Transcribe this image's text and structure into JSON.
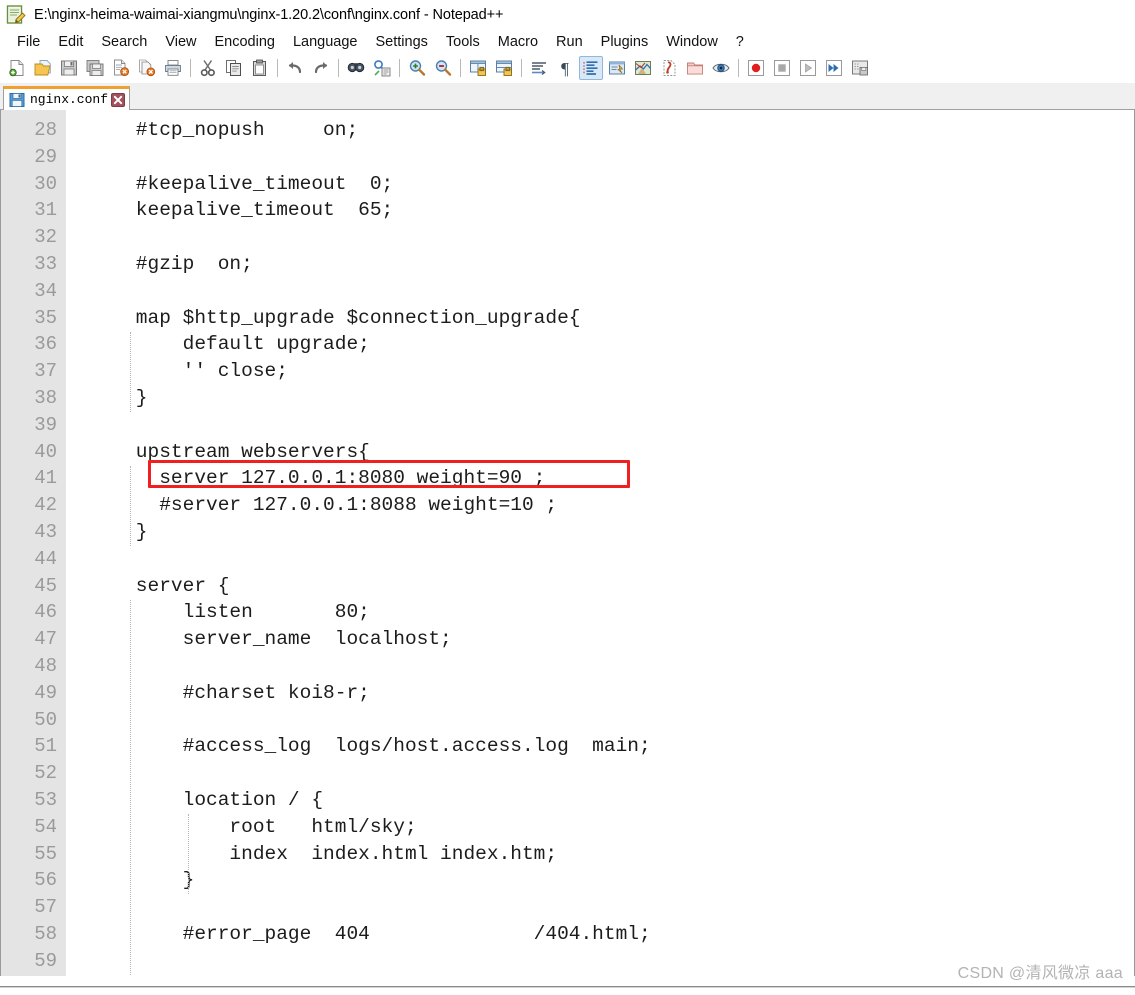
{
  "window": {
    "title": "E:\\nginx-heima-waimai-xiangmu\\nginx-1.20.2\\conf\\nginx.conf - Notepad++",
    "app_icon": "notepad-plus-plus-icon"
  },
  "menubar": {
    "items": [
      {
        "label": "File",
        "name": "menu-file"
      },
      {
        "label": "Edit",
        "name": "menu-edit"
      },
      {
        "label": "Search",
        "name": "menu-search"
      },
      {
        "label": "View",
        "name": "menu-view"
      },
      {
        "label": "Encoding",
        "name": "menu-encoding"
      },
      {
        "label": "Language",
        "name": "menu-language"
      },
      {
        "label": "Settings",
        "name": "menu-settings"
      },
      {
        "label": "Tools",
        "name": "menu-tools"
      },
      {
        "label": "Macro",
        "name": "menu-macro"
      },
      {
        "label": "Run",
        "name": "menu-run"
      },
      {
        "label": "Plugins",
        "name": "menu-plugins"
      },
      {
        "label": "Window",
        "name": "menu-window"
      },
      {
        "label": "?",
        "name": "menu-help"
      }
    ]
  },
  "toolbar": {
    "buttons": [
      {
        "icon": "new-file-icon",
        "label": "New"
      },
      {
        "icon": "open-file-icon",
        "label": "Open"
      },
      {
        "icon": "save-icon",
        "label": "Save"
      },
      {
        "icon": "save-all-icon",
        "label": "Save All"
      },
      {
        "icon": "close-file-icon",
        "label": "Close"
      },
      {
        "icon": "close-all-icon",
        "label": "Close All"
      },
      {
        "icon": "print-icon",
        "label": "Print"
      },
      {
        "sep": true
      },
      {
        "icon": "cut-icon",
        "label": "Cut"
      },
      {
        "icon": "copy-icon",
        "label": "Copy"
      },
      {
        "icon": "paste-icon",
        "label": "Paste"
      },
      {
        "sep": true
      },
      {
        "icon": "undo-icon",
        "label": "Undo"
      },
      {
        "icon": "redo-icon",
        "label": "Redo"
      },
      {
        "sep": true
      },
      {
        "icon": "find-icon",
        "label": "Find"
      },
      {
        "icon": "replace-icon",
        "label": "Replace"
      },
      {
        "sep": true
      },
      {
        "icon": "zoom-in-icon",
        "label": "Zoom In"
      },
      {
        "icon": "zoom-out-icon",
        "label": "Zoom Out"
      },
      {
        "sep": true
      },
      {
        "icon": "sync-vertical-icon",
        "label": "Synchronize Vertical Scrolling"
      },
      {
        "icon": "sync-horizontal-icon",
        "label": "Synchronize Horizontal Scrolling"
      },
      {
        "sep": true
      },
      {
        "icon": "word-wrap-icon",
        "label": "Word wrap"
      },
      {
        "icon": "show-all-chars-icon",
        "label": "Show All Characters"
      },
      {
        "icon": "indent-guide-icon",
        "label": "Show Indent Guide",
        "active": true
      },
      {
        "icon": "user-defined-dialog-icon",
        "label": "User Defined Dialogue"
      },
      {
        "icon": "document-map-icon",
        "label": "Document Map"
      },
      {
        "icon": "function-list-icon",
        "label": "Function List"
      },
      {
        "icon": "folder-workspace-icon",
        "label": "Folder as Workspace"
      },
      {
        "icon": "monitoring-icon",
        "label": "Monitoring"
      },
      {
        "sep": true
      },
      {
        "icon": "record-macro-icon",
        "label": "Start Recording"
      },
      {
        "icon": "stop-macro-icon",
        "label": "Stop Recording"
      },
      {
        "icon": "play-macro-icon",
        "label": "Playback"
      },
      {
        "icon": "run-multiple-macro-icon",
        "label": "Run a Macro Multiple Times"
      },
      {
        "icon": "save-macro-icon",
        "label": "Save Current Recorded Macro"
      }
    ]
  },
  "tabs": [
    {
      "label": "nginx.conf",
      "icon": "saved-file-icon",
      "close_icon": "close-icon",
      "active": true
    }
  ],
  "editor": {
    "first_line_number": 28,
    "lines": [
      {
        "n": 28,
        "text": "    #tcp_nopush     on;"
      },
      {
        "n": 29,
        "text": ""
      },
      {
        "n": 30,
        "text": "    #keepalive_timeout  0;"
      },
      {
        "n": 31,
        "text": "    keepalive_timeout  65;"
      },
      {
        "n": 32,
        "text": ""
      },
      {
        "n": 33,
        "text": "    #gzip  on;"
      },
      {
        "n": 34,
        "text": ""
      },
      {
        "n": 35,
        "text": "    map $http_upgrade $connection_upgrade{"
      },
      {
        "n": 36,
        "text": "        default upgrade;"
      },
      {
        "n": 37,
        "text": "        '' close;"
      },
      {
        "n": 38,
        "text": "    }"
      },
      {
        "n": 39,
        "text": ""
      },
      {
        "n": 40,
        "text": "    upstream webservers{"
      },
      {
        "n": 41,
        "text": "      server 127.0.0.1:8080 weight=90 ;"
      },
      {
        "n": 42,
        "text": "      #server 127.0.0.1:8088 weight=10 ;"
      },
      {
        "n": 43,
        "text": "    }"
      },
      {
        "n": 44,
        "text": ""
      },
      {
        "n": 45,
        "text": "    server {"
      },
      {
        "n": 46,
        "text": "        listen       80;"
      },
      {
        "n": 47,
        "text": "        server_name  localhost;"
      },
      {
        "n": 48,
        "text": ""
      },
      {
        "n": 49,
        "text": "        #charset koi8-r;"
      },
      {
        "n": 50,
        "text": ""
      },
      {
        "n": 51,
        "text": "        #access_log  logs/host.access.log  main;"
      },
      {
        "n": 52,
        "text": ""
      },
      {
        "n": 53,
        "text": "        location / {"
      },
      {
        "n": 54,
        "text": "            root   html/sky;"
      },
      {
        "n": 55,
        "text": "            index  index.html index.htm;"
      },
      {
        "n": 56,
        "text": "        }"
      },
      {
        "n": 57,
        "text": ""
      },
      {
        "n": 58,
        "text": "        #error_page  404              /404.html;"
      },
      {
        "n": 59,
        "text": ""
      }
    ],
    "highlight": {
      "name": "server-line-highlight",
      "color": "#f02020",
      "target_line": 41,
      "target_text": "server 127.0.0.1:8080 weight=90 ;"
    }
  },
  "watermark": {
    "text": "CSDN @清风微凉 aaa"
  },
  "colors": {
    "gutter_bg": "#e4e4e4",
    "line_number": "#9a9a9a",
    "code_text": "#1c1c1c",
    "tab_top_accent": "#f0a030",
    "highlight_red": "#f02020"
  }
}
